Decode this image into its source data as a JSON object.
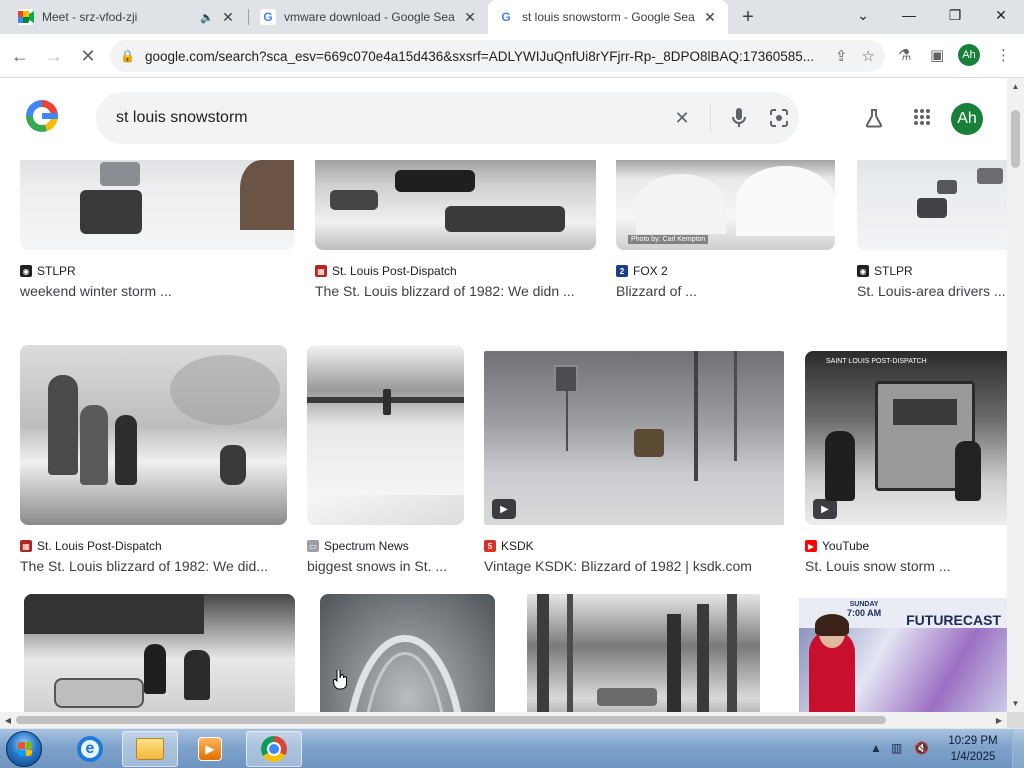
{
  "tabs": [
    {
      "label": "Meet - srz-vfod-zji",
      "favicon": "meet-icon",
      "muted": true
    },
    {
      "label": "vmware download - Google Sea",
      "favicon": "google-icon"
    },
    {
      "label": "st louis snowstorm - Google Sea",
      "favicon": "google-icon",
      "active": true
    }
  ],
  "newtab_label": "+",
  "window_controls": {
    "dropdown": "⌄",
    "minimize": "—",
    "restore": "❐",
    "close": "✕"
  },
  "address": {
    "url": "google.com/search?sca_esv=669c070e4a15d436&sxsrf=ADLYWIJuQnfUi8rYFjrr-Rp-_8DPO8lBAQ:17360585..."
  },
  "search": {
    "query": "st louis snowstorm",
    "profile_initials": "Ah"
  },
  "results": {
    "row1": [
      {
        "source": "STLPR",
        "title": "weekend winter storm ...",
        "fav_color": "#202124",
        "fav_glyph": "◉"
      },
      {
        "source": "St. Louis Post-Dispatch",
        "title": "The St. Louis blizzard of 1982: We didn ...",
        "fav_color": "#b3261e",
        "fav_glyph": "▦"
      },
      {
        "source": "FOX 2",
        "title": "Blizzard of ...",
        "fav_color": "#1a3e8c",
        "fav_glyph": "2",
        "overlay": "Photo by: Carl Kempton"
      },
      {
        "source": "STLPR",
        "title": "St. Louis-area drivers ...",
        "fav_color": "#202124",
        "fav_glyph": "◉"
      }
    ],
    "row2": [
      {
        "source": "St. Louis Post-Dispatch",
        "title": "The St. Louis blizzard of 1982: We did...",
        "fav_color": "#b3261e",
        "fav_glyph": "▦"
      },
      {
        "source": "Spectrum News",
        "title": "biggest snows in St. ...",
        "fav_color": "#9aa0a6",
        "fav_glyph": "▭"
      },
      {
        "source": "KSDK",
        "title": "Vintage KSDK: Blizzard of 1982 | ksdk.com",
        "fav_color": "#d93025",
        "fav_glyph": "5",
        "video": true
      },
      {
        "source": "YouTube",
        "title": "St. Louis snow storm ...",
        "fav_color": "#ff0000",
        "fav_glyph": "▶",
        "video": true,
        "overlay": "SAINT LOUIS POST-DISPATCH"
      }
    ],
    "row3": [
      {
        "thumb": "row3a"
      },
      {
        "thumb": "arch"
      },
      {
        "thumb": "row3c"
      },
      {
        "thumb": "futurecast",
        "overlay_title": "FUTURECAST",
        "overlay_day": "SUNDAY",
        "overlay_time": "7:00 AM"
      }
    ]
  },
  "taskbar": {
    "clock_time": "10:29 PM",
    "clock_date": "1/4/2025"
  },
  "colors": {
    "accent_green": "#188038",
    "tabstrip_bg": "#dfe3e8",
    "omnibox_bg": "#f1f3f4"
  }
}
